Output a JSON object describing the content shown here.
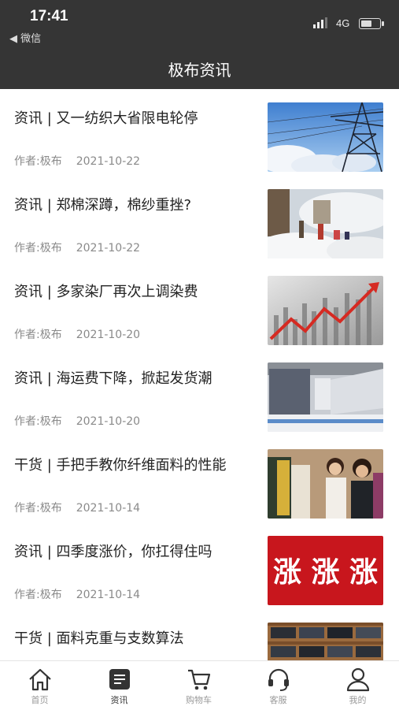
{
  "status_bar": {
    "time": "17:41",
    "back_label": "◀ 微信",
    "network": "4G",
    "battery_level": 0.6
  },
  "header": {
    "title": "极布资讯"
  },
  "articles": [
    {
      "title": "资讯 | 又一纺织大省限电轮停",
      "author": "作者:极布",
      "date": "2021-10-22",
      "thumb_icon": "power-tower-image"
    },
    {
      "title": "资讯 | 郑棉深蹲，棉纱重挫?",
      "author": "作者:极布",
      "date": "2021-10-22",
      "thumb_icon": "cotton-harvest-image"
    },
    {
      "title": "资讯 | 多家染厂再次上调染费",
      "author": "作者:极布",
      "date": "2021-10-20",
      "thumb_icon": "rising-arrow-image"
    },
    {
      "title": "资讯 | 海运费下降，掀起发货潮",
      "author": "作者:极布",
      "date": "2021-10-20",
      "thumb_icon": "shipping-containers-image"
    },
    {
      "title": "干货 | 手把手教你纤维面料的性能",
      "author": "作者:极布",
      "date": "2021-10-14",
      "thumb_icon": "clothing-shopping-image"
    },
    {
      "title": "资讯 | 四季度涨价，你扛得住吗",
      "author": "作者:极布",
      "date": "2021-10-14",
      "thumb_icon": "price-rise-image",
      "thumb_text": "涨 涨 涨"
    },
    {
      "title": "干货 | 面料克重与支数算法",
      "author": "",
      "date": "",
      "thumb_icon": "fabric-shelf-image"
    }
  ],
  "tabbar": {
    "items": [
      {
        "label": "首页",
        "icon": "home-icon",
        "active": false
      },
      {
        "label": "资讯",
        "icon": "news-icon",
        "active": true
      },
      {
        "label": "购物车",
        "icon": "cart-icon",
        "active": false
      },
      {
        "label": "客服",
        "icon": "headset-icon",
        "active": false
      },
      {
        "label": "我的",
        "icon": "user-icon",
        "active": false
      }
    ]
  },
  "colors": {
    "header_bg": "#353535",
    "text": "#222222",
    "meta": "#8a8a8a",
    "tab_inactive": "#999999",
    "tab_active": "#333333",
    "price_red": "#c8161d"
  }
}
